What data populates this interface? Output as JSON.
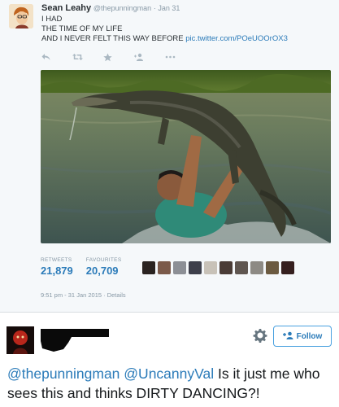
{
  "tweet": {
    "display_name": "Sean Leahy",
    "screen_name": "@thepunningman",
    "date": "· Jan 31",
    "lines": [
      "I HAD",
      "THE TIME OF MY LIFE",
      "AND I NEVER FELT THIS WAY BEFORE"
    ],
    "link": "pic.twitter.com/POeUOOrOX3",
    "actions": [
      "reply-icon",
      "retweet-icon",
      "favorite-icon",
      "follow-icon",
      "more-icon"
    ],
    "stats": {
      "retweets_label": "RETWEETS",
      "retweets": "21,879",
      "favorites_label": "FAVOURITES",
      "favorites": "20,709"
    },
    "timestamp": "9:51 pm - 31 Jan 2015 · Details"
  },
  "reply": {
    "follow_label": "Follow",
    "mention1": "@thepunningman",
    "mention2": "@UncannyVal",
    "text": "Is it just me who sees this and thinks DIRTY DANCING?!"
  },
  "colors": {
    "accent": "#2b7bb9",
    "muted": "#8899a6",
    "panel": "#f5f8fa"
  }
}
